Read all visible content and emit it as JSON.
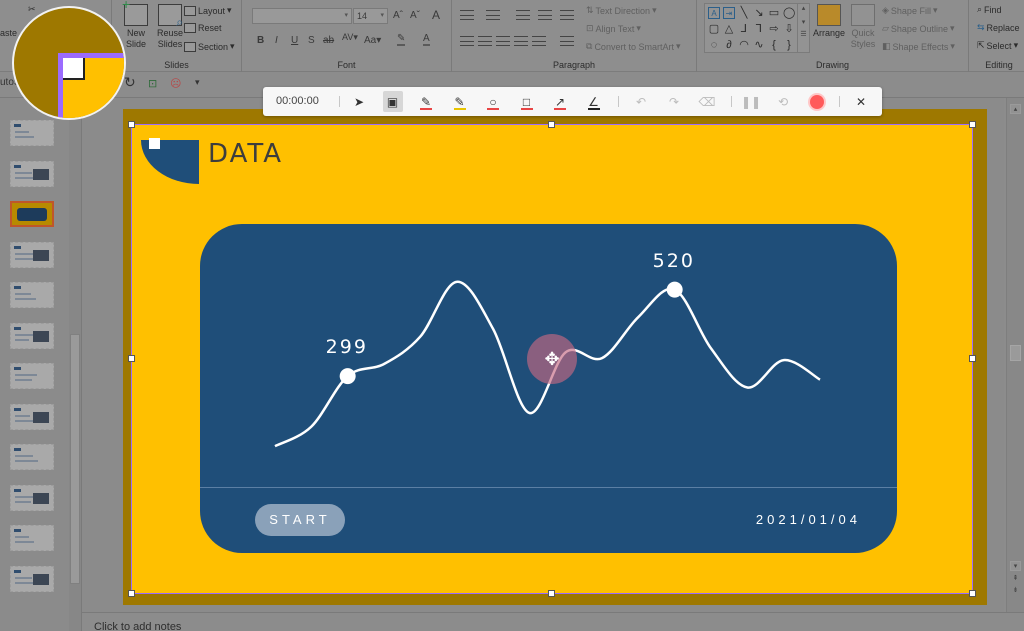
{
  "ribbon": {
    "clipboard": {
      "paste_label": "aste",
      "cut_icon": "scissors-icon",
      "copy_label": "C"
    },
    "slides": {
      "new_slide": "New Slide",
      "reuse_slides": "Reuse Slides",
      "layout": "Layout",
      "reset": "Reset",
      "section": "Section",
      "group_label": "Slides"
    },
    "font": {
      "font_name": "",
      "font_size": "14",
      "grow": "A",
      "shrink": "A",
      "clear": "A",
      "bold": "B",
      "italic": "I",
      "underline": "U",
      "shadow": "S",
      "strike": "ab",
      "spacing": "AV",
      "case": "Aa",
      "highlight": "✎",
      "font_color": "A",
      "group_label": "Font"
    },
    "paragraph": {
      "text_direction": "Text Direction",
      "align_text": "Align Text",
      "convert_smartart": "Convert to SmartArt",
      "group_label": "Paragraph"
    },
    "drawing": {
      "arrange": "Arrange",
      "quick_styles": "Quick Styles",
      "shape_fill": "Shape Fill",
      "shape_outline": "Shape Outline",
      "shape_effects": "Shape Effects",
      "group_label": "Drawing",
      "shapes": [
        "A",
        "⇥",
        "╲",
        "↘",
        "▭",
        "◯",
        "▢",
        "△",
        "⅃",
        "⅂",
        "⇨",
        "⇩",
        "◌",
        "∂",
        "◠",
        "∿",
        "{",
        "}"
      ]
    },
    "editing": {
      "find": "Find",
      "replace": "Replace",
      "select": "Select",
      "group_label": "Editing"
    }
  },
  "qat": {
    "autosave": "utoS",
    "undo_icon": "redo-icon",
    "present_icon": "present-icon",
    "accessibility_icon": "accessibility-icon",
    "more": "▾"
  },
  "recorder": {
    "time": "00:00:00",
    "tools": [
      {
        "name": "pointer",
        "glyph": "➤"
      },
      {
        "name": "screen-frame",
        "glyph": "▣"
      },
      {
        "name": "pen",
        "glyph": "✎",
        "color": "#e84545"
      },
      {
        "name": "highlighter",
        "glyph": "✎",
        "color": "#e8c400"
      },
      {
        "name": "ellipse",
        "glyph": "○",
        "color": "#e84545"
      },
      {
        "name": "rectangle",
        "glyph": "□",
        "color": "#e84545"
      },
      {
        "name": "arrow",
        "glyph": "↗",
        "color": "#e84545"
      },
      {
        "name": "line",
        "glyph": "∠",
        "color": "#222222"
      }
    ],
    "actions": [
      {
        "name": "undo",
        "glyph": "↶"
      },
      {
        "name": "redo",
        "glyph": "↷"
      },
      {
        "name": "clear",
        "glyph": "⌫"
      }
    ],
    "pause": "❚❚",
    "restart": "⟲",
    "record_color": "#ff5a5a",
    "close": "✕"
  },
  "slide": {
    "title": "DATA",
    "start_button": "START",
    "date": "2021/01/04",
    "colors": {
      "background": "#ffc000",
      "panel": "#1f4e79",
      "logo": "#1f4e79",
      "line": "#ffffff"
    }
  },
  "chart_data": {
    "type": "line",
    "title": "",
    "xlabel": "",
    "ylabel": "",
    "smooth": true,
    "grid": false,
    "x": [
      0,
      1,
      2,
      3,
      4,
      5,
      6,
      7,
      8,
      9,
      10,
      11,
      12,
      13,
      14,
      15
    ],
    "values": [
      120,
      170,
      299,
      330,
      400,
      540,
      420,
      205,
      360,
      345,
      450,
      520,
      370,
      270,
      340,
      290
    ],
    "annotations": [
      {
        "index": 2,
        "label": "299"
      },
      {
        "index": 11,
        "label": "520"
      }
    ],
    "ylim": [
      100,
      560
    ]
  },
  "notes": {
    "placeholder": "Click to add notes"
  },
  "thumbnails": {
    "count": 12,
    "active_index": 2
  }
}
